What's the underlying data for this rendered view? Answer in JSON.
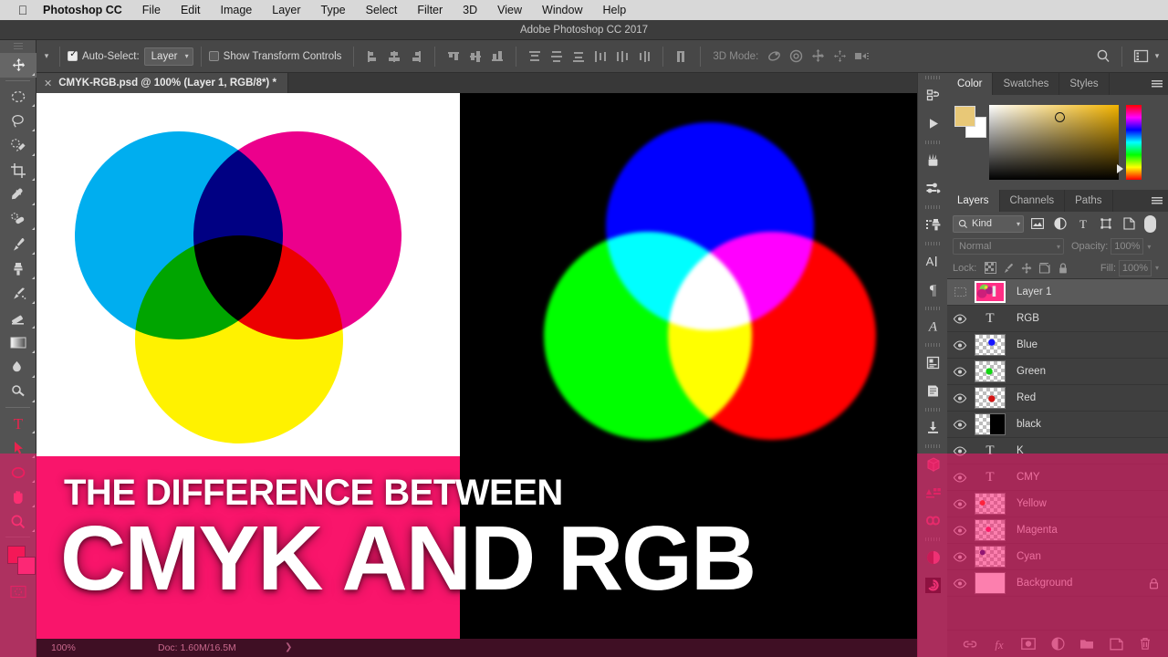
{
  "menubar": {
    "apple_icon": "apple-icon",
    "items": [
      {
        "label": "Photoshop CC",
        "bold": true
      },
      {
        "label": "File"
      },
      {
        "label": "Edit"
      },
      {
        "label": "Image"
      },
      {
        "label": "Layer"
      },
      {
        "label": "Type"
      },
      {
        "label": "Select"
      },
      {
        "label": "Filter"
      },
      {
        "label": "3D"
      },
      {
        "label": "View"
      },
      {
        "label": "Window"
      },
      {
        "label": "Help"
      }
    ]
  },
  "titlebar": {
    "title": "Adobe Photoshop CC 2017"
  },
  "options_bar": {
    "tool_icon": "move-tool-icon",
    "auto_select_checked": true,
    "auto_select_label": "Auto-Select:",
    "auto_select_value": "Layer",
    "show_transform_checked": false,
    "show_transform_label": "Show Transform Controls",
    "three_d_mode_label": "3D Mode:",
    "search_icon": "search-icon",
    "workspace_icon": "workspace-switcher-icon"
  },
  "document_tab": {
    "close_icon": "close-icon",
    "title": "CMYK-RGB.psd @ 100% (Layer 1, RGB/8*) *"
  },
  "toolbar": {
    "tools": [
      {
        "name": "move-tool",
        "icon": "move-icon",
        "selected": true
      },
      {
        "name": "marquee-tool",
        "icon": "elliptical-marquee-icon"
      },
      {
        "name": "lasso-tool",
        "icon": "lasso-icon"
      },
      {
        "name": "quick-selection-tool",
        "icon": "quick-selection-icon"
      },
      {
        "name": "crop-tool",
        "icon": "crop-icon"
      },
      {
        "name": "eyedropper-tool",
        "icon": "eyedropper-icon"
      },
      {
        "name": "healing-brush-tool",
        "icon": "spot-healing-icon"
      },
      {
        "name": "brush-tool",
        "icon": "brush-icon"
      },
      {
        "name": "clone-stamp-tool",
        "icon": "clone-stamp-icon"
      },
      {
        "name": "history-brush-tool",
        "icon": "history-brush-icon"
      },
      {
        "name": "eraser-tool",
        "icon": "eraser-icon"
      },
      {
        "name": "gradient-tool",
        "icon": "gradient-icon"
      },
      {
        "name": "blur-tool",
        "icon": "blur-icon"
      },
      {
        "name": "dodge-tool",
        "icon": "dodge-icon"
      },
      {
        "name": "pen-tool",
        "icon": "pen-icon"
      },
      {
        "name": "type-tool",
        "icon": "type-icon"
      },
      {
        "name": "path-selection-tool",
        "icon": "path-selection-icon"
      },
      {
        "name": "ellipse-tool",
        "icon": "ellipse-shape-icon"
      },
      {
        "name": "hand-tool",
        "icon": "hand-icon"
      },
      {
        "name": "zoom-tool",
        "icon": "zoom-icon"
      }
    ],
    "foreground_color": "#ee1c3e",
    "background_color": "#ff3e82",
    "quick_mask_icon": "quick-mask-icon"
  },
  "right_rail": {
    "icons": [
      "history-icon",
      "actions-play-icon",
      "brush-presets-icon",
      "brush-settings-icon",
      "clone-source-icon",
      "character-icon",
      "paragraph-icon",
      "glyphs-icon",
      "character-styles-icon",
      "paragraph-styles-icon",
      "export-icon",
      "3d-icon",
      "adobe-stock-icon",
      "creative-cloud-libraries-icon",
      "adjustments-icon",
      "cc-apps-icon"
    ]
  },
  "color_panel": {
    "tabs": [
      {
        "label": "Color",
        "active": true
      },
      {
        "label": "Swatches",
        "active": false
      },
      {
        "label": "Styles",
        "active": false
      }
    ],
    "menu_icon": "panel-menu-icon",
    "foreground_swatch": "#e8c877",
    "background_swatch": "#ffffff",
    "ramp_color": "#f2b300"
  },
  "layers_panel": {
    "tabs": [
      {
        "label": "Layers",
        "active": true
      },
      {
        "label": "Channels",
        "active": false
      },
      {
        "label": "Paths",
        "active": false
      }
    ],
    "menu_icon": "panel-menu-icon",
    "filter": {
      "search_icon": "search-icon",
      "kind_label": "Kind",
      "icons": [
        "filter-pixel-icon",
        "filter-adjustment-icon",
        "filter-type-icon",
        "filter-shape-icon",
        "filter-smart-object-icon"
      ],
      "toggle": "filter-toggle"
    },
    "blend_mode": "Normal",
    "opacity_label": "Opacity:",
    "opacity_value": "100%",
    "lock_label": "Lock:",
    "lock_icons": [
      "lock-transparent-pixels-icon",
      "lock-image-pixels-icon",
      "lock-position-icon",
      "lock-artboard-icon",
      "lock-all-icon"
    ],
    "fill_label": "Fill:",
    "fill_value": "100%",
    "layers": [
      {
        "name": "Layer 1",
        "visible": false,
        "type": "image",
        "selected": true,
        "locked": false,
        "tinted": false
      },
      {
        "name": "RGB",
        "visible": true,
        "type": "text",
        "selected": false,
        "locked": false,
        "tinted": false
      },
      {
        "name": "Blue",
        "visible": true,
        "type": "image",
        "selected": false,
        "locked": false,
        "tinted": false,
        "dot": "#1414ff"
      },
      {
        "name": "Green",
        "visible": true,
        "type": "image",
        "selected": false,
        "locked": false,
        "tinted": false,
        "dot": "#14d414"
      },
      {
        "name": "Red",
        "visible": true,
        "type": "image",
        "selected": false,
        "locked": false,
        "tinted": false,
        "dot": "#d41414"
      },
      {
        "name": "black",
        "visible": true,
        "type": "image",
        "selected": false,
        "locked": false,
        "tinted": true
      },
      {
        "name": "K",
        "visible": true,
        "type": "text",
        "selected": false,
        "locked": false,
        "tinted": true
      },
      {
        "name": "CMY",
        "visible": true,
        "type": "text",
        "selected": false,
        "locked": false,
        "tinted": true
      },
      {
        "name": "Yellow",
        "visible": true,
        "type": "image",
        "selected": false,
        "locked": false,
        "tinted": true,
        "dot": "#ff3000"
      },
      {
        "name": "Magenta",
        "visible": true,
        "type": "image",
        "selected": false,
        "locked": false,
        "tinted": true,
        "dot": "#ff2060"
      },
      {
        "name": "Cyan",
        "visible": true,
        "type": "image",
        "selected": false,
        "locked": false,
        "tinted": true,
        "dot": "#14147a"
      },
      {
        "name": "Background",
        "visible": true,
        "type": "solid",
        "selected": false,
        "locked": true,
        "tinted": true
      }
    ],
    "bottom_icons": [
      "link-layers-icon",
      "add-layer-style-icon",
      "add-layer-mask-icon",
      "new-adjustment-layer-icon",
      "new-group-icon",
      "new-layer-icon",
      "delete-layer-icon"
    ]
  },
  "status_bar": {
    "zoom": "100%",
    "doc": "Doc: 1.60M/16.5M",
    "arrow_icon": "chevron-right-icon"
  },
  "canvas": {
    "banner_line1": "THE DIFFERENCE BETWEEN",
    "banner_line2": "CMYK AND RGB",
    "banner_color": "#f9156b",
    "cmyk": {
      "background": "#ffffff",
      "circles": [
        {
          "name": "cyan-circle",
          "color": "#00aeef"
        },
        {
          "name": "magenta-circle",
          "color": "#ec008c"
        },
        {
          "name": "yellow-circle",
          "color": "#fff200"
        }
      ]
    },
    "rgb": {
      "background": "#000000",
      "circles": [
        {
          "name": "blue-circle",
          "color": "#0000ff"
        },
        {
          "name": "green-circle",
          "color": "#00ff00"
        },
        {
          "name": "red-circle",
          "color": "#ff0000"
        }
      ]
    }
  }
}
